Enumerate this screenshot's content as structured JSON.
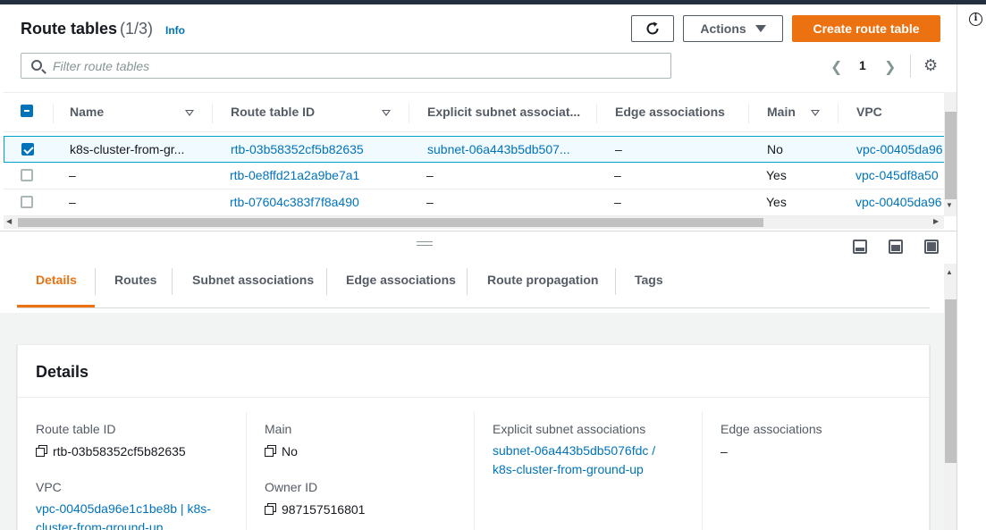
{
  "header": {
    "title": "Route tables",
    "count": "(1/3)",
    "info_label": "Info",
    "actions_label": "Actions",
    "create_label": "Create route table"
  },
  "search": {
    "placeholder": "Filter route tables"
  },
  "pagination": {
    "current_page": "1"
  },
  "table": {
    "columns": [
      "Name",
      "Route table ID",
      "Explicit subnet associat...",
      "Edge associations",
      "Main",
      "VPC"
    ],
    "rows": [
      {
        "name": "k8s-cluster-from-gr...",
        "id": "rtb-03b58352cf5b82635",
        "subnet": "subnet-06a443b5db507...",
        "edge": "–",
        "main": "No",
        "vpc": "vpc-00405da96",
        "selected": true
      },
      {
        "name": "–",
        "id": "rtb-0e8ffd21a2a9be7a1",
        "subnet": "–",
        "edge": "–",
        "main": "Yes",
        "vpc": "vpc-045df8a50",
        "selected": false
      },
      {
        "name": "–",
        "id": "rtb-07604c383f7f8a490",
        "subnet": "–",
        "edge": "–",
        "main": "Yes",
        "vpc": "vpc-00405da96",
        "selected": false
      }
    ]
  },
  "tabs": [
    "Details",
    "Routes",
    "Subnet associations",
    "Edge associations",
    "Route propagation",
    "Tags"
  ],
  "details": {
    "title": "Details",
    "route_table_id_label": "Route table ID",
    "route_table_id_value": "rtb-03b58352cf5b82635",
    "main_label": "Main",
    "main_value": "No",
    "subnet_label": "Explicit subnet associations",
    "subnet_value_line1": "subnet-06a443b5db5076fdc /",
    "subnet_value_line2": "k8s-cluster-from-ground-up",
    "edge_label": "Edge associations",
    "edge_value": "–",
    "vpc_label": "VPC",
    "vpc_value_line1": "vpc-00405da96e1c1be8b | k8s-",
    "vpc_value_line2": "cluster-from-ground-up",
    "owner_label": "Owner ID",
    "owner_value": "987157516801"
  },
  "colors": {
    "accent": "#ec7211",
    "link": "#0073bb",
    "selected_row_bg": "#f1faff",
    "selected_row_border": "#00a1c9"
  }
}
